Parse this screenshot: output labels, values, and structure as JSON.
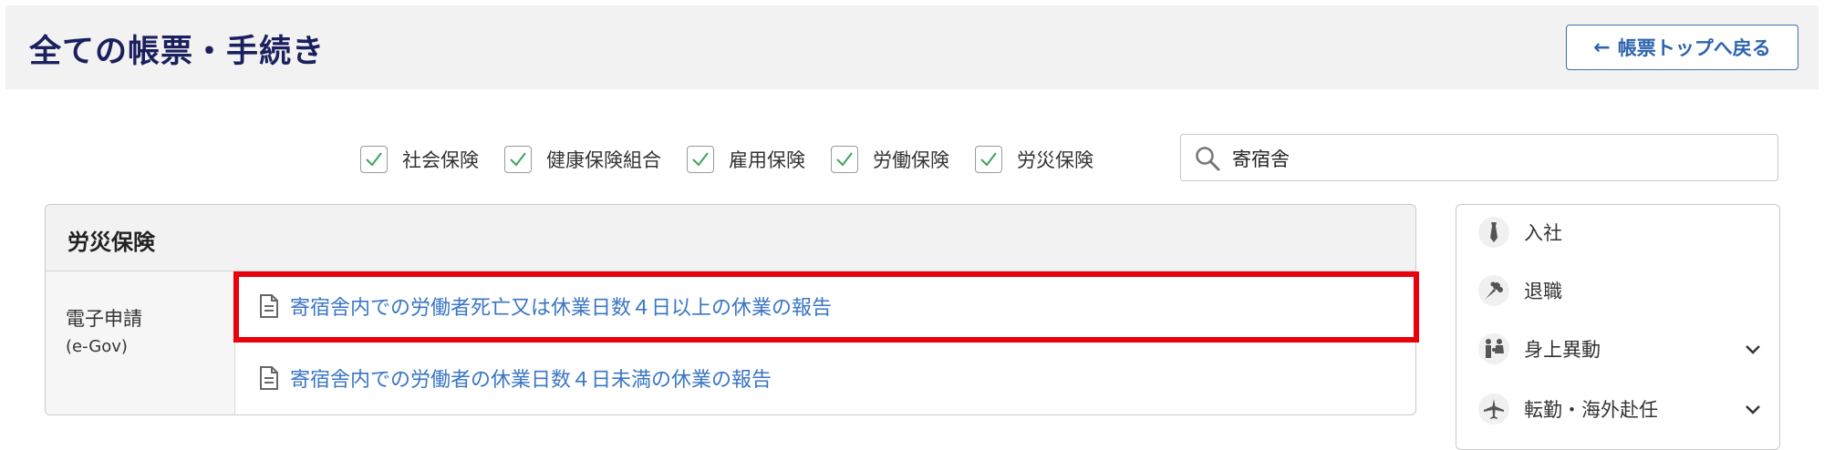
{
  "header": {
    "title": "全ての帳票・手続き",
    "back_label": "帳票トップへ戻る",
    "back_arrow": "←"
  },
  "filters": [
    {
      "label": "社会保険",
      "checked": true
    },
    {
      "label": "健康保険組合",
      "checked": true
    },
    {
      "label": "雇用保険",
      "checked": true
    },
    {
      "label": "労働保険",
      "checked": true
    },
    {
      "label": "労災保険",
      "checked": true
    }
  ],
  "search": {
    "value": "寄宿舎",
    "icon": "search-icon"
  },
  "panel": {
    "title": "労災保険",
    "category": {
      "label": "電子申請",
      "sub": "(e-Gov)"
    },
    "forms": [
      {
        "label": "寄宿舎内での労働者死亡又は休業日数４日以上の休業の報告",
        "icon": "document-icon"
      },
      {
        "label": "寄宿舎内での労働者の休業日数４日未満の休業の報告",
        "icon": "document-icon"
      }
    ]
  },
  "sidebar": {
    "items": [
      {
        "label": "入社",
        "icon": "tie-icon",
        "expandable": false
      },
      {
        "label": "退職",
        "icon": "bouquet-icon",
        "expandable": false
      },
      {
        "label": "身上異動",
        "icon": "family-icon",
        "expandable": true
      },
      {
        "label": "転勤・海外赴任",
        "icon": "airplane-icon",
        "expandable": true
      }
    ]
  },
  "colors": {
    "title": "#1b1f5e",
    "link": "#3a76c4",
    "highlight": "#e8000b",
    "check": "#3aa35a"
  }
}
